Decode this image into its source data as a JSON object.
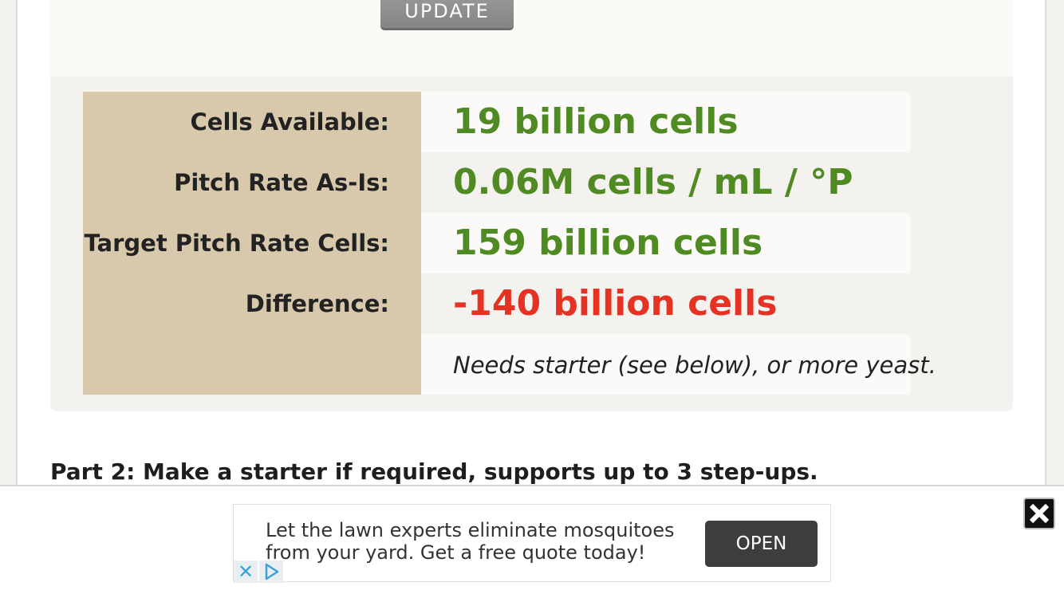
{
  "form": {
    "update_label": "UPDATE"
  },
  "results": [
    {
      "label": "Cells Available:",
      "value": "19 billion cells",
      "status": "positive"
    },
    {
      "label": "Pitch Rate As-Is:",
      "value": "0.06M cells / mL / °P",
      "status": "positive"
    },
    {
      "label": "Target Pitch Rate Cells:",
      "value": "159 billion cells",
      "status": "positive"
    },
    {
      "label": "Difference:",
      "value": "-140 billion cells",
      "status": "negative"
    }
  ],
  "results_note": "Needs starter (see below), or more yeast.",
  "part2_heading": "Part 2: Make a starter if required, supports up to 3 step-ups.",
  "ad": {
    "text": "Let the lawn experts eliminate mosquitoes from your yard. Get a free quote today!",
    "cta_label": "OPEN"
  },
  "colors": {
    "positive": "#4f8a22",
    "negative": "#e53222",
    "label_bg": "#d8c9ad"
  },
  "icons": {
    "close_ad": "close-icon",
    "ad_choices_close": "x-icon",
    "ad_choices_info": "play-triangle-icon"
  }
}
